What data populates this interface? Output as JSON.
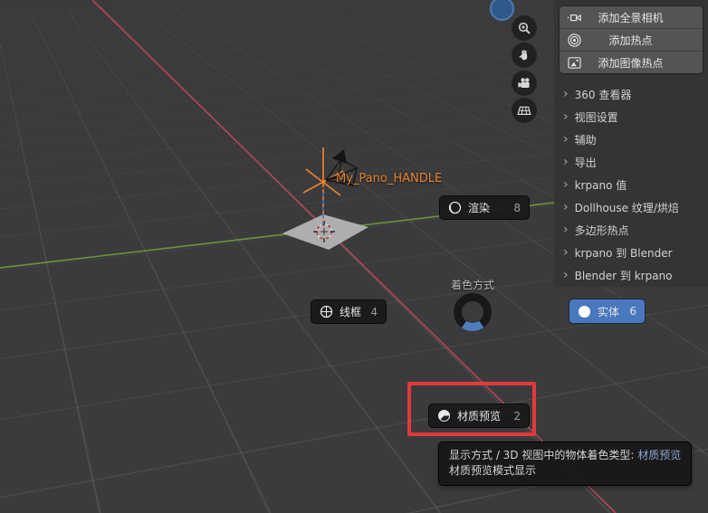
{
  "colors": {
    "viewport_bg": "#3b3b3d",
    "sidebar_bg": "#343436",
    "accent_blue": "#4a78bd",
    "axis_x_red": "#ad4750",
    "axis_y_green": "#6d9138",
    "object_orange": "#e8832e",
    "annotation_red": "#e23a3c",
    "tooltip_highlight_blue": "#8ea9cf"
  },
  "sidebar": {
    "action_buttons": [
      {
        "label": "添加全景相机",
        "icon": "panorama-camera-icon"
      },
      {
        "label": "添加热点",
        "icon": "hotspot-icon"
      },
      {
        "label": "添加图像热点",
        "icon": "image-hotspot-icon"
      }
    ],
    "sections": [
      {
        "label": "360 查看器"
      },
      {
        "label": "视图设置"
      },
      {
        "label": "辅助"
      },
      {
        "label": "导出"
      },
      {
        "label": "krpano 值"
      },
      {
        "label": "Dollhouse 纹理/烘焙"
      },
      {
        "label": "多边形热点"
      },
      {
        "label": "krpano 到 Blender"
      },
      {
        "label": "Blender 到 krpano"
      }
    ]
  },
  "viewport": {
    "object_label": "My_Pano_HANDLE",
    "nav_icons": [
      "zoom-in-icon",
      "pan-hand-icon",
      "camera-view-icon",
      "perspective-grid-icon"
    ]
  },
  "pie_menu": {
    "title": "着色方式",
    "items": [
      {
        "label": "线框",
        "shortcut": "4",
        "icon": "wireframe-sphere-icon",
        "state": "normal"
      },
      {
        "label": "渲染",
        "shortcut": "8",
        "icon": "rendered-sphere-icon",
        "state": "normal"
      },
      {
        "label": "实体",
        "shortcut": "6",
        "icon": "solid-sphere-icon",
        "state": "selected"
      },
      {
        "label": "材质预览",
        "shortcut": "2",
        "icon": "material-sphere-icon",
        "state": "highlighted"
      }
    ]
  },
  "tooltip": {
    "line1_prefix": "显示方式 / 3D 视图中的物体着色类型: ",
    "line1_value": "材质预览",
    "line2": "材质预览模式显示"
  }
}
